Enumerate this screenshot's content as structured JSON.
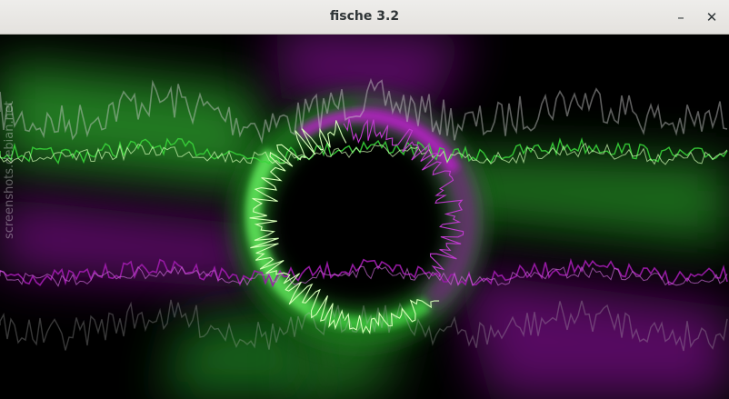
{
  "window": {
    "title": "fische 3.2",
    "controls": {
      "minimize": "–",
      "close": "✕"
    }
  },
  "visualizer": {
    "colors": {
      "green": "#39d53a",
      "purple": "#9a1aa8",
      "light_green": "#d6ffb8",
      "background": "#000000"
    }
  },
  "watermark": {
    "text": "screenshots.debian.net"
  }
}
